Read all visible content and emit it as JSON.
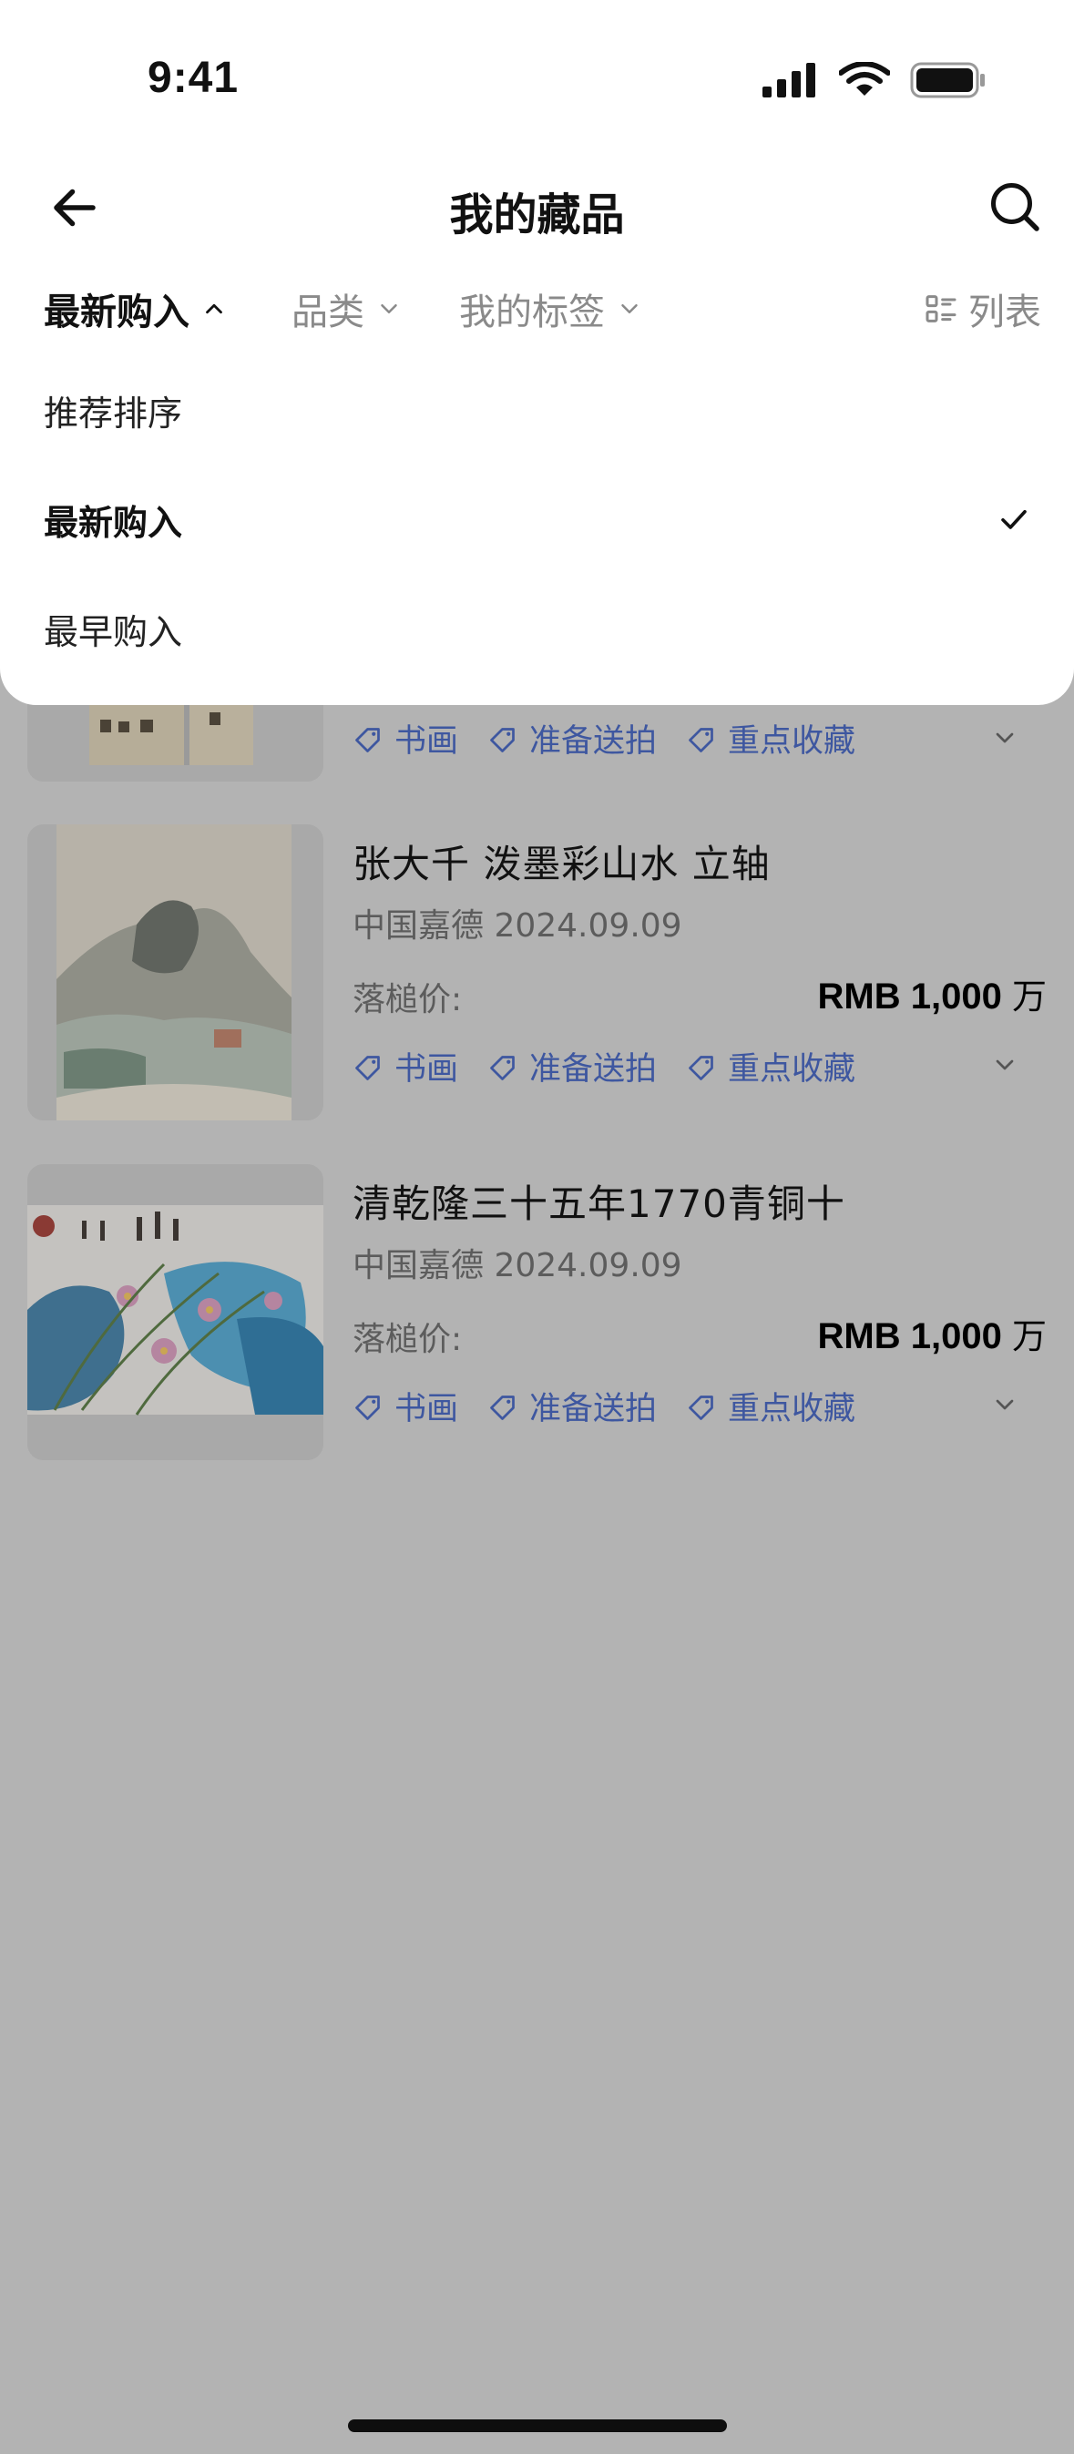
{
  "status_bar": {
    "time": "9:41"
  },
  "nav": {
    "title": "我的藏品"
  },
  "filters": {
    "sort_label": "最新购入",
    "category_label": "品类",
    "tags_label": "我的标签",
    "view_label": "列表"
  },
  "sort_options": [
    {
      "label": "推荐排序",
      "selected": false
    },
    {
      "label": "最新购入",
      "selected": true
    },
    {
      "label": "最早购入",
      "selected": false
    }
  ],
  "items": [
    {
      "partial": true,
      "tags": [
        "书画",
        "准备送拍",
        "重点收藏"
      ]
    },
    {
      "title": "张大千 泼墨彩山水 立轴",
      "subtitle": "中国嘉德 2024.09.09",
      "price_label": "落槌价:",
      "price_currency": "RMB",
      "price_value": "1,000",
      "price_unit": "万",
      "tags": [
        "书画",
        "准备送拍",
        "重点收藏"
      ]
    },
    {
      "title": "清乾隆三十五年1770青铜十",
      "subtitle": "中国嘉德 2024.09.09",
      "price_label": "落槌价:",
      "price_currency": "RMB",
      "price_value": "1,000",
      "price_unit": "万",
      "tags": [
        "书画",
        "准备送拍",
        "重点收藏"
      ]
    }
  ],
  "colors": {
    "overlay_bg": "#b3b3b3",
    "tag_text": "#3e57a0",
    "sheet_bg": "#ffffff"
  }
}
